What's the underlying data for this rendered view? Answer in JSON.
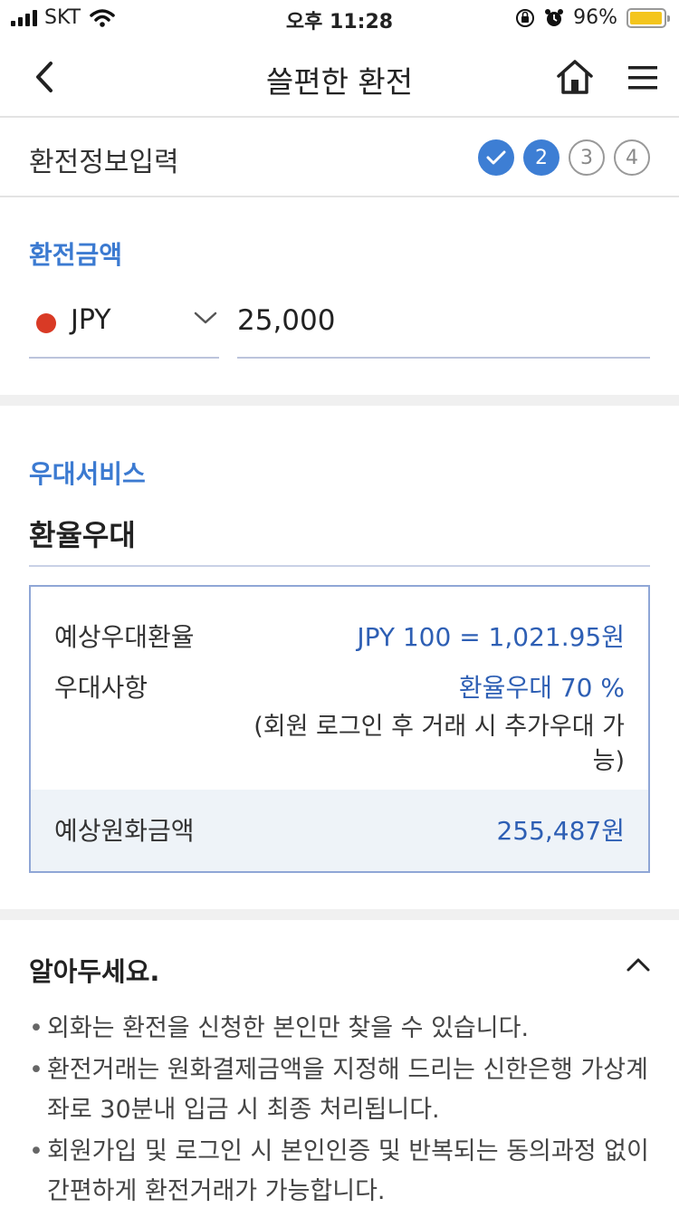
{
  "status_bar": {
    "carrier": "SKT",
    "time": "오후 11:28",
    "battery_text": "96%",
    "battery_level": 0.96,
    "battery_color": "#f4c51d"
  },
  "nav": {
    "title": "쓸편한 환전",
    "back_icon": "chevron-left-icon",
    "home_icon": "home-icon",
    "menu_icon": "hamburger-menu-icon"
  },
  "step_header": {
    "title": "환전정보입력",
    "steps": [
      {
        "label": "✓",
        "state": "done"
      },
      {
        "label": "2",
        "state": "active"
      },
      {
        "label": "3",
        "state": "todo"
      },
      {
        "label": "4",
        "state": "todo"
      }
    ]
  },
  "amount": {
    "section_label": "환전금액",
    "currency": "JPY",
    "currency_dot_color": "#d93a25",
    "value": "25,000"
  },
  "preferential": {
    "section_label": "우대서비스",
    "type": "환율우대",
    "rate_label": "예상우대환율",
    "rate_value": "JPY 100 = 1,021.95원",
    "benefit_label": "우대사항",
    "benefit_value": "환율우대 70 %",
    "benefit_note": "(회원 로그인 후 거래 시 추가우대 가능)",
    "total_label": "예상원화금액",
    "total_value": "255,487원"
  },
  "notice": {
    "title": "알아두세요.",
    "items": [
      "외화는 환전을 신청한 본인만 찾을 수 있습니다.",
      "환전거래는 원화결제금액을 지정해 드리는 신한은행 가상계좌로 30분내 입금 시 최종 처리됩니다.",
      "회원가입 및 로그인 시 본인인증 및 반복되는 동의과정 없이 간편하게 환전거래가 가능합니다."
    ]
  },
  "colors": {
    "accent": "#3b7ad1",
    "value_blue": "#2e5fb4",
    "step_active": "#3d7ed4"
  }
}
